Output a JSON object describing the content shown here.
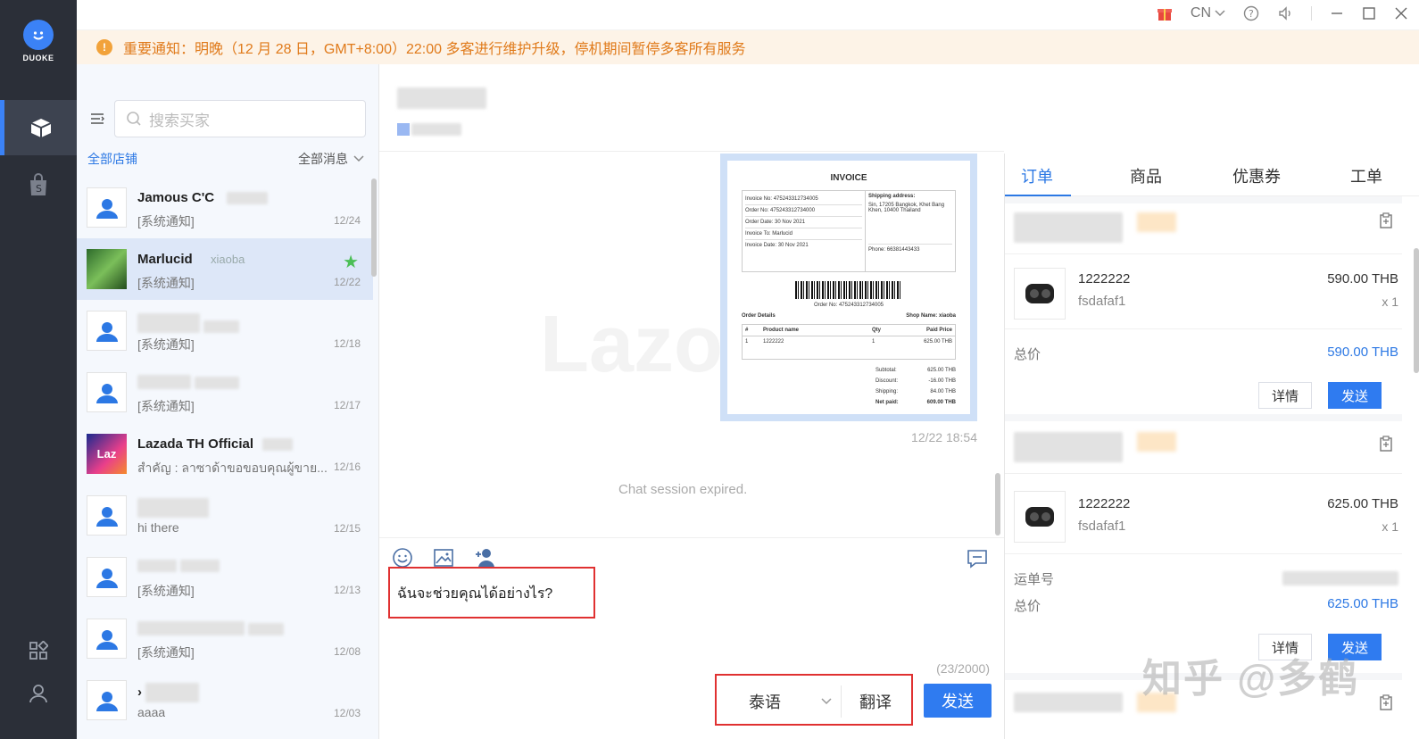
{
  "app": {
    "logo_text": "DUOKE"
  },
  "topbar": {
    "lang": "CN"
  },
  "notice": {
    "text": "重要通知：明晚（12 月 28 日，GMT+8:00）22:00 多客进行维护升级，停机期间暂停多客所有服务"
  },
  "sidebar": {
    "search_placeholder": "搜索买家",
    "store_filter": "全部店铺",
    "message_filter": "全部消息",
    "conversations": [
      {
        "name": "Jamous C'C",
        "sub": "",
        "preview": "[系统通知]",
        "date": "12/24"
      },
      {
        "name": "Marlucid",
        "sub": "xiaoba",
        "preview": "[系统通知]",
        "date": "12/22"
      },
      {
        "name": "",
        "sub": "",
        "preview": "[系统通知]",
        "date": "12/18"
      },
      {
        "name": "",
        "sub": "",
        "preview": "[系统通知]",
        "date": "12/17"
      },
      {
        "name": "Lazada TH Official",
        "sub": "",
        "preview": "สำคัญ : ลาซาด้าขอขอบคุณผู้ขาย...",
        "date": "12/16"
      },
      {
        "name": "",
        "sub": "",
        "preview": "hi there",
        "date": "12/15"
      },
      {
        "name": "",
        "sub": "",
        "preview": "[系统通知]",
        "date": "12/13"
      },
      {
        "name": "",
        "sub": "",
        "preview": "[系统通知]",
        "date": "12/08"
      },
      {
        "name": "›",
        "sub": "",
        "preview": "aaaa",
        "date": "12/03"
      }
    ],
    "lazada_avatar": "Laz"
  },
  "chat": {
    "invoice": {
      "title": "INVOICE",
      "invoice_no_label": "Invoice No:",
      "invoice_no": "475243312734005",
      "order_no_label": "Order No:",
      "order_no": "475243312734000",
      "order_date_label": "Order Date:",
      "order_date": "30 Nov 2021",
      "invoice_to_label": "Invoice To:",
      "invoice_to": "Marlucid",
      "invoice_date_label": "Invoice Date:",
      "invoice_date": "30 Nov 2021",
      "shipping_label": "Shipping address:",
      "shipping_address": "Sin, 17205 Bangkok, Khet Bang Khen, 10400 Thailand",
      "phone_label": "Phone:",
      "phone": "66381443433",
      "order_no_short": "Order No:",
      "order_details": "Order Details",
      "shop_name_label": "Shop Name:",
      "shop_name": "xiaoba",
      "cols": [
        "#",
        "Product name",
        "Qty",
        "Paid Price"
      ],
      "row": [
        "1",
        "1222222",
        "1",
        "625.00 THB"
      ],
      "subtotal_label": "Subtotal:",
      "subtotal": "625.00 THB",
      "discount_label": "Discount:",
      "discount": "-16.00 THB",
      "shipping_fee_label": "Shipping:",
      "shipping_fee": "84.00 THB",
      "net_label": "Net paid:",
      "net": "609.00 THB"
    },
    "watermark": "Lazo",
    "msg_time": "12/22 18:54",
    "expired": "Chat session expired.",
    "input_text": "ฉันจะช่วยคุณได้อย่างไร?",
    "counter": "(23/2000)",
    "language": "泰语",
    "translate": "翻译",
    "send": "发送"
  },
  "orders": {
    "tabs": [
      "订单",
      "商品",
      "优惠券",
      "工单"
    ],
    "cards": [
      {
        "product_id": "1222222",
        "product_name": "fsdafaf1",
        "price": "590.00 THB",
        "qty": "x 1",
        "total_label": "总价",
        "total": "590.00 THB",
        "detail": "详情",
        "send": "发送"
      },
      {
        "product_id": "1222222",
        "product_name": "fsdafaf1",
        "price": "625.00 THB",
        "qty": "x 1",
        "tracking_label": "运单号",
        "total_label": "总价",
        "total": "625.00 THB",
        "detail": "详情",
        "send": "发送"
      }
    ]
  },
  "watermark": "知乎 @多鹤",
  "colors": {
    "accent": "#2f7bf0",
    "rail": "#2b2f38",
    "notice_bg": "#fdf3e7",
    "notice_text": "#e07a1a",
    "highlight": "#e03131"
  }
}
